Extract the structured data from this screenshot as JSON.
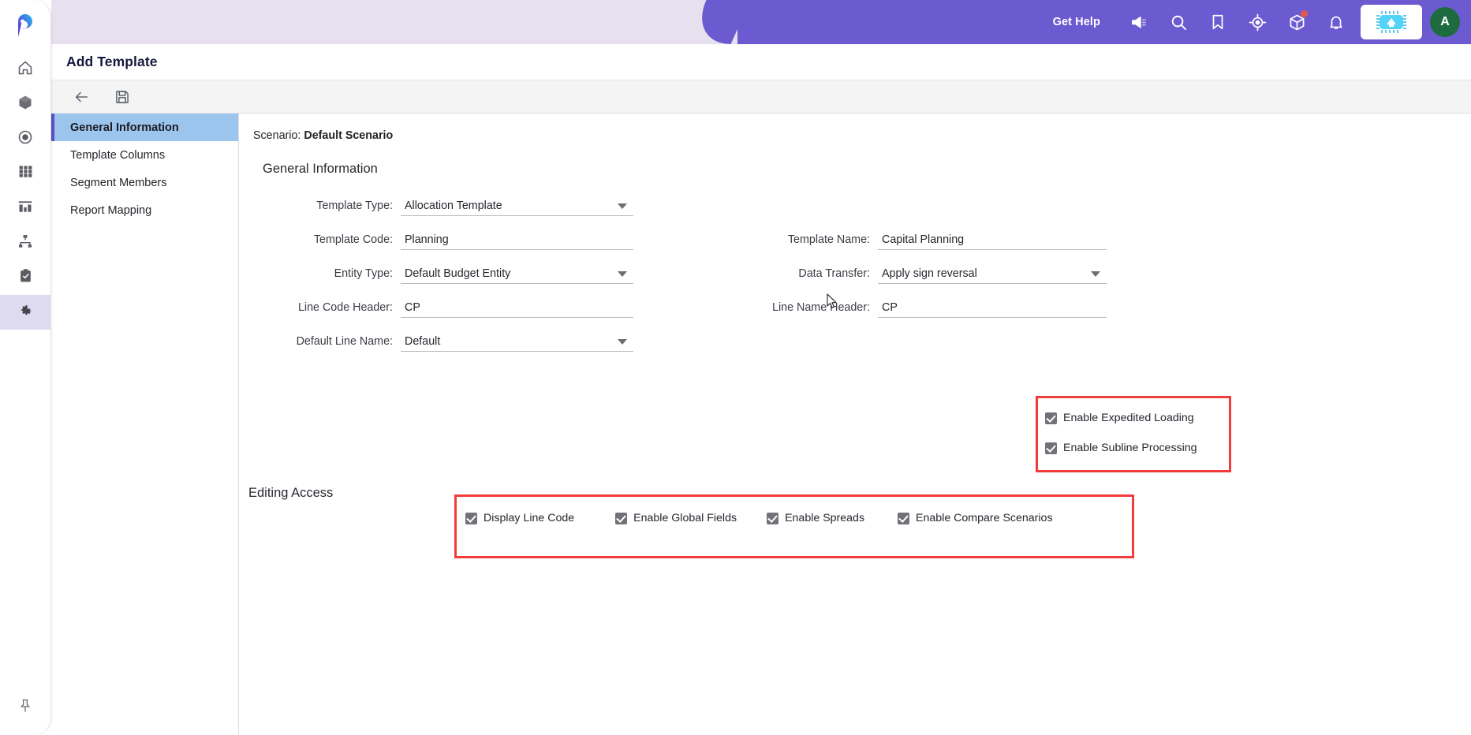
{
  "header": {
    "get_help_label": "Get Help",
    "icons": [
      {
        "name": "announcement-icon",
        "glyph": "announcement"
      },
      {
        "name": "search-icon",
        "glyph": "search"
      },
      {
        "name": "bookmark-icon",
        "glyph": "bookmark"
      },
      {
        "name": "target-icon",
        "glyph": "target"
      },
      {
        "name": "package-icon",
        "glyph": "package",
        "badge": true
      },
      {
        "name": "notifications-bell-icon",
        "glyph": "bell"
      }
    ],
    "avatar_initial": "A",
    "brand_chip": "chip-logo",
    "accent_color": "#6c5bd0",
    "header_bg": "#e7e1ef"
  },
  "rail": {
    "logo": "planful-logo",
    "items": [
      {
        "name": "home-icon",
        "label": "Home"
      },
      {
        "name": "cube-icon",
        "label": "Structures"
      },
      {
        "name": "target-dot-icon",
        "label": "Scenarios"
      },
      {
        "name": "grid-icon",
        "label": "Grids"
      },
      {
        "name": "chart-icon",
        "label": "Reports"
      },
      {
        "name": "hierarchy-icon",
        "label": "Hierarchy"
      },
      {
        "name": "clipboard-check-icon",
        "label": "Tasks"
      },
      {
        "name": "gear-icon",
        "label": "Maintenance",
        "active": true
      }
    ],
    "bottom_item": {
      "name": "pin-icon",
      "label": "Pin Menu"
    }
  },
  "page": {
    "title": "Add Template"
  },
  "toolbar": {
    "back_label": "Back",
    "save_label": "Save"
  },
  "leftnav": {
    "items": [
      {
        "label": "General Information",
        "active": true
      },
      {
        "label": "Template Columns",
        "active": false
      },
      {
        "label": "Segment Members",
        "active": false
      },
      {
        "label": "Report Mapping",
        "active": false
      }
    ]
  },
  "content": {
    "scenario_prefix": "Scenario:",
    "scenario_value": "Default Scenario",
    "section_title": "General Information",
    "fields_left": [
      {
        "label": "Template Type:",
        "value": "Allocation Template",
        "type": "select"
      },
      {
        "label": "Template Code:",
        "value": "Planning",
        "type": "text"
      },
      {
        "label": "Entity Type:",
        "value": "Default Budget Entity",
        "type": "select"
      },
      {
        "label": "Line Code Header:",
        "value": "CP",
        "type": "text"
      },
      {
        "label": "Default Line Name:",
        "value": "Default",
        "type": "select"
      }
    ],
    "fields_right": [
      {
        "label": "Template Name:",
        "value": "Capital Planning",
        "type": "text"
      },
      {
        "label": "Data Transfer:",
        "value": "Apply sign reversal",
        "type": "select"
      },
      {
        "label": "Line Name Header:",
        "value": "CP",
        "type": "text"
      }
    ],
    "flag_checkboxes": [
      {
        "label": "Enable Expedited Loading",
        "checked": true
      },
      {
        "label": "Enable Subline Processing",
        "checked": true
      }
    ],
    "editing_access_title": "Editing Access",
    "editing_checkboxes": [
      {
        "label": "Display Line Code",
        "checked": true
      },
      {
        "label": "Enable Global Fields",
        "checked": true
      },
      {
        "label": "Enable Spreads",
        "checked": true
      },
      {
        "label": "Enable Compare Scenarios",
        "checked": true
      }
    ],
    "highlight_color": "#f23b3b"
  }
}
